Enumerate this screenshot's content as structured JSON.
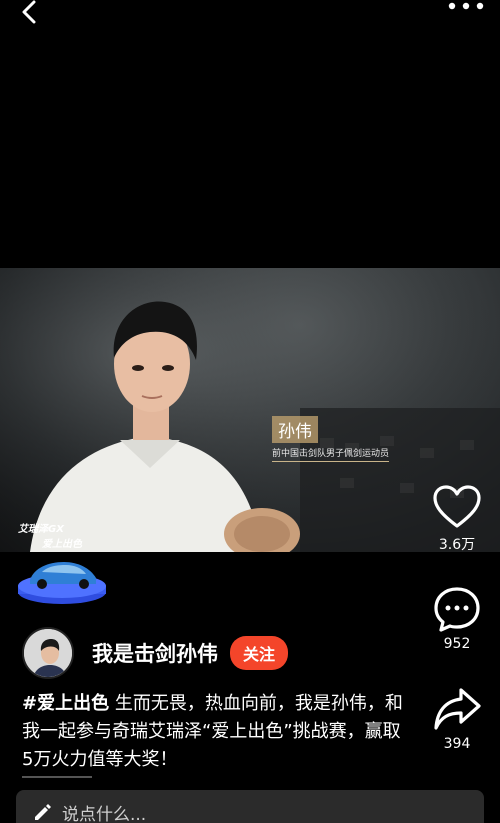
{
  "video": {
    "name_card": {
      "name": "孙伟",
      "title": "前中国击剑队男子佩剑运动员"
    },
    "brand_logo": {
      "line1": "艾瑞泽GX",
      "line2": "爱上出色"
    }
  },
  "actions": {
    "like_count": "3.6万",
    "comment_count": "952",
    "share_count": "394"
  },
  "author": {
    "name": "我是击剑孙伟",
    "follow_label": "关注"
  },
  "caption": {
    "hashtag": "#爱上出色",
    "text": " 生而无畏，热血向前，我是孙伟，和我一起参与奇瑞艾瑞泽“爱上出色”挑战赛，赢取5万火力值等大奖！"
  },
  "comment_input": {
    "placeholder": "说点什么..."
  },
  "icons": {
    "back": "back-arrow-icon",
    "more": "more-dots-icon",
    "like": "heart-icon",
    "comment": "comment-bubble-icon",
    "share": "share-arrow-icon",
    "edit": "pencil-icon"
  },
  "colors": {
    "follow_button": "#f4452a",
    "name_card_bg": "#bea06e",
    "badge_blue": "#2f4de0"
  }
}
